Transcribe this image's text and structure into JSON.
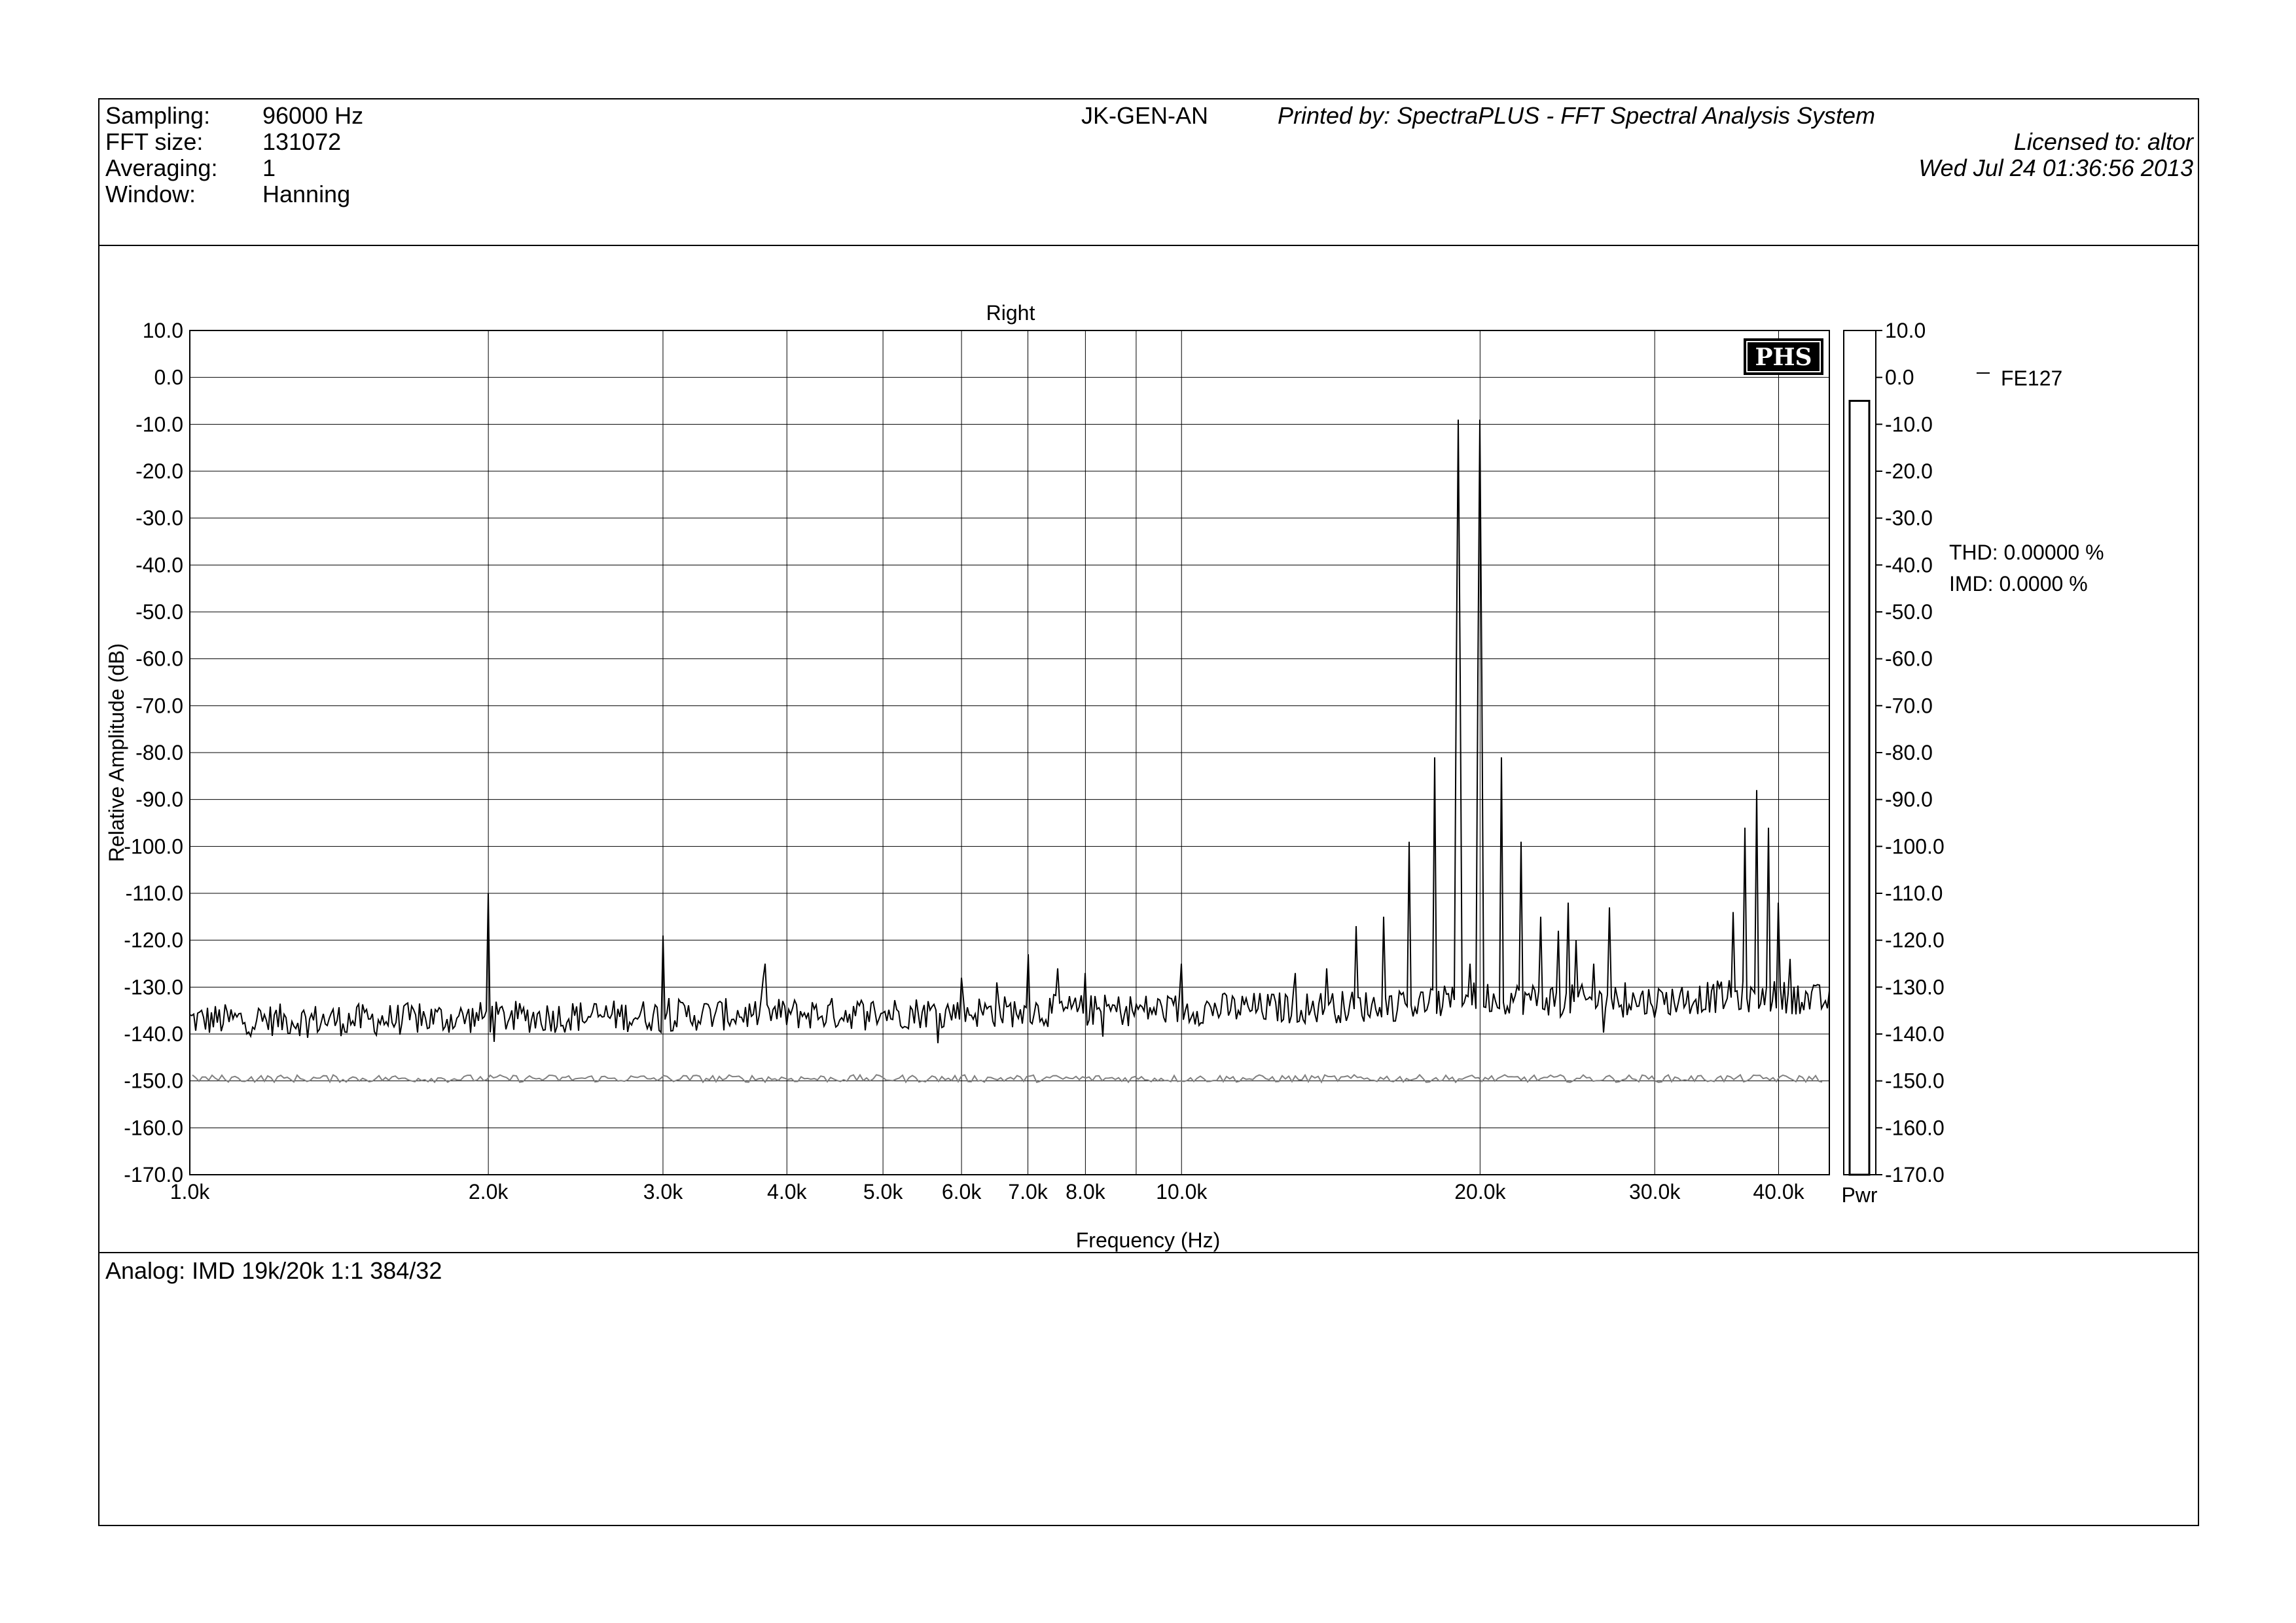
{
  "header": {
    "sampling_label": "Sampling:",
    "sampling_value": "96000 Hz",
    "fft_label": "FFT size:",
    "fft_value": "131072",
    "averaging_label": "Averaging:",
    "averaging_value": "1",
    "window_label": "Window:",
    "window_value": "Hanning",
    "device": "JK-GEN-AN",
    "printed_by": "Printed by: SpectraPLUS - FFT Spectral Analysis System",
    "licensed_to": "Licensed to: altor",
    "timestamp": "Wed Jul 24 01:36:56 2013"
  },
  "footer": {
    "analog_label": "Analog: IMD 19k/20k 1:1 384/32"
  },
  "logo": {
    "text": "PHS"
  },
  "side": {
    "legend_series": "FE127",
    "thd": "THD: 0.00000 %",
    "imd": "IMD: 0.0000 %",
    "pwr_label": "Pwr",
    "pwr_level_db": -5
  },
  "chart_data": {
    "type": "line",
    "title": "Right",
    "xlabel": "Frequency (Hz)",
    "ylabel": "Relative Amplitude (dB)",
    "x_scale": "log",
    "xlim": [
      1000,
      45000
    ],
    "ylim": [
      -170,
      10
    ],
    "grid": true,
    "x_ticks": [
      1000,
      2000,
      3000,
      4000,
      5000,
      6000,
      7000,
      8000,
      10000,
      20000,
      30000,
      40000
    ],
    "x_tick_labels": [
      "1.0k",
      "2.0k",
      "3.0k",
      "4.0k",
      "5.0k",
      "6.0k",
      "7.0k",
      "8.0k",
      "10.0k",
      "20.0k",
      "30.0k",
      "40.0k"
    ],
    "x_grid_extra": [
      9000
    ],
    "y_ticks": [
      10,
      0,
      -10,
      -20,
      -30,
      -40,
      -50,
      -60,
      -70,
      -80,
      -90,
      -100,
      -110,
      -120,
      -130,
      -140,
      -150,
      -160,
      -170
    ],
    "y_tick_labels": [
      "10.0",
      "0.0",
      "-10.0",
      "-20.0",
      "-30.0",
      "-40.0",
      "-50.0",
      "-60.0",
      "-70.0",
      "-80.0",
      "-90.0",
      "-100.0",
      "-110.0",
      "-120.0",
      "-130.0",
      "-140.0",
      "-150.0",
      "-160.0",
      "-170.0"
    ],
    "series": [
      {
        "name": "FE127",
        "color": "#000000",
        "noise_floor": {
          "f": [
            1000,
            1500,
            2000,
            3000,
            5000,
            8000,
            12000,
            16000,
            19000,
            20000,
            22000,
            26000,
            30000,
            35000,
            40000,
            45000
          ],
          "db": [
            -137,
            -137,
            -136.5,
            -136,
            -135.5,
            -135,
            -134.5,
            -134,
            -133,
            -132,
            -132.5,
            -133,
            -133,
            -132,
            -132,
            -133
          ]
        },
        "peaks": [
          {
            "f": 1020,
            "db": -143
          },
          {
            "f": 2000,
            "db": -110
          },
          {
            "f": 3000,
            "db": -119
          },
          {
            "f": 3800,
            "db": -125
          },
          {
            "f": 6000,
            "db": -128
          },
          {
            "f": 6500,
            "db": -129
          },
          {
            "f": 7000,
            "db": -123
          },
          {
            "f": 7500,
            "db": -126
          },
          {
            "f": 8000,
            "db": -127
          },
          {
            "f": 10000,
            "db": -125
          },
          {
            "f": 13000,
            "db": -127
          },
          {
            "f": 14000,
            "db": -126
          },
          {
            "f": 15000,
            "db": -117
          },
          {
            "f": 16000,
            "db": -115
          },
          {
            "f": 17000,
            "db": -99
          },
          {
            "f": 18000,
            "db": -81
          },
          {
            "f": 19000,
            "db": -9
          },
          {
            "f": 19500,
            "db": -125
          },
          {
            "f": 20000,
            "db": -9
          },
          {
            "f": 21000,
            "db": -81
          },
          {
            "f": 22000,
            "db": -99
          },
          {
            "f": 23000,
            "db": -115
          },
          {
            "f": 24000,
            "db": -118
          },
          {
            "f": 24500,
            "db": -112
          },
          {
            "f": 25000,
            "db": -120
          },
          {
            "f": 26000,
            "db": -125
          },
          {
            "f": 27000,
            "db": -113
          },
          {
            "f": 28000,
            "db": -129
          },
          {
            "f": 36000,
            "db": -114
          },
          {
            "f": 37000,
            "db": -96
          },
          {
            "f": 38000,
            "db": -88
          },
          {
            "f": 39000,
            "db": -96
          },
          {
            "f": 40000,
            "db": -112
          },
          {
            "f": 41000,
            "db": -124
          }
        ]
      },
      {
        "name": "",
        "color": "#808080",
        "style": "noise reference",
        "level_db": -149.5
      }
    ]
  }
}
